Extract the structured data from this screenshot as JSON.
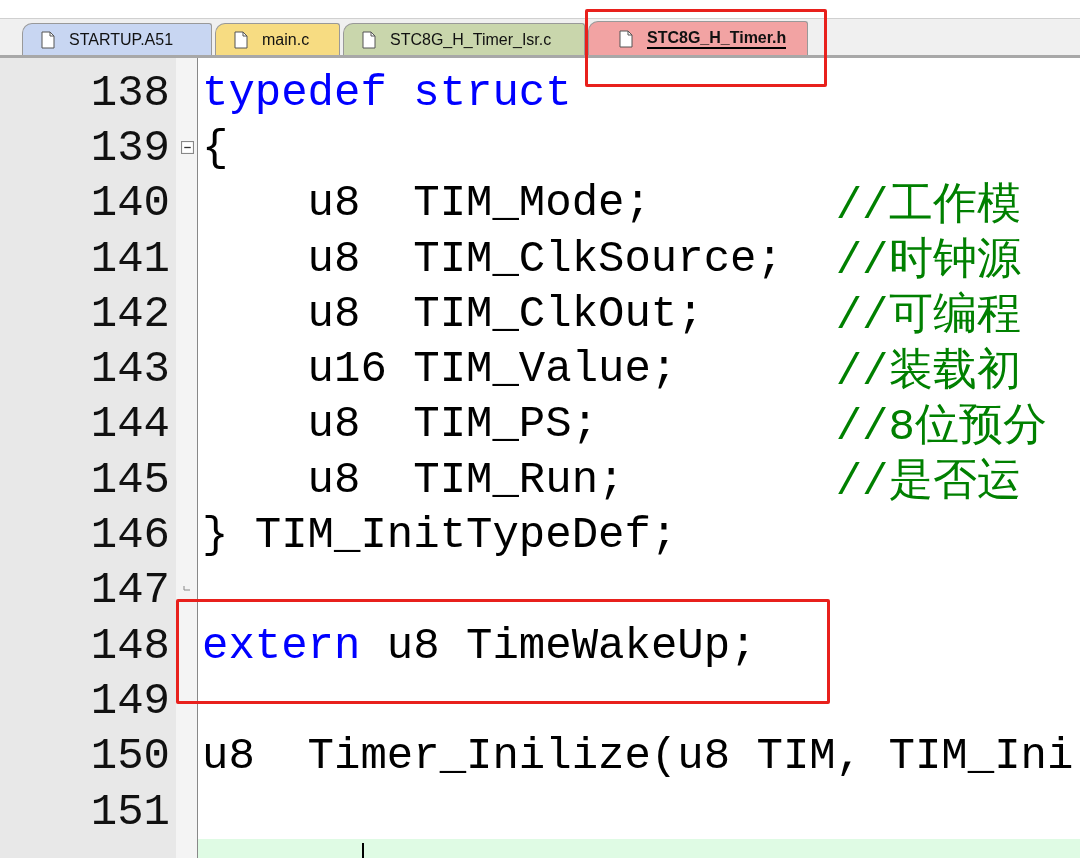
{
  "tabs": [
    {
      "label": "STARTUP.A51",
      "selected": false,
      "color": "#c8d6f2"
    },
    {
      "label": "main.c",
      "selected": false,
      "color": "#f7dc82"
    },
    {
      "label": "STC8G_H_Timer_Isr.c",
      "selected": false,
      "color": "#c9d6ac"
    },
    {
      "label": "STC8G_H_Timer.h",
      "selected": true,
      "color": "#f2a3a3"
    }
  ],
  "editor": {
    "lines": [
      {
        "number": "138",
        "tokens": [
          {
            "text": "typedef struct",
            "kind": "keyword"
          }
        ]
      },
      {
        "number": "139",
        "fold_start": true,
        "tokens": [
          {
            "text": "{",
            "kind": "text"
          }
        ]
      },
      {
        "number": "140",
        "tokens": [
          {
            "text": "    u8  TIM_Mode;",
            "kind": "text"
          },
          {
            "text": "//工作模",
            "kind": "comment"
          }
        ]
      },
      {
        "number": "141",
        "tokens": [
          {
            "text": "    u8  TIM_ClkSource;",
            "kind": "text"
          },
          {
            "text": "//时钟源",
            "kind": "comment"
          }
        ]
      },
      {
        "number": "142",
        "tokens": [
          {
            "text": "    u8  TIM_ClkOut;",
            "kind": "text"
          },
          {
            "text": "//可编程",
            "kind": "comment"
          }
        ]
      },
      {
        "number": "143",
        "tokens": [
          {
            "text": "    u16 TIM_Value;",
            "kind": "text"
          },
          {
            "text": "//装载初",
            "kind": "comment"
          }
        ]
      },
      {
        "number": "144",
        "tokens": [
          {
            "text": "    u8  TIM_PS;",
            "kind": "text"
          },
          {
            "text": "//8位预分",
            "kind": "comment"
          }
        ]
      },
      {
        "number": "145",
        "tokens": [
          {
            "text": "    u8  TIM_Run;",
            "kind": "text"
          },
          {
            "text": "//是否运",
            "kind": "comment"
          }
        ]
      },
      {
        "number": "146",
        "tokens": [
          {
            "text": "} TIM_InitTypeDef;",
            "kind": "text"
          }
        ]
      },
      {
        "number": "147",
        "fold_end": true
      },
      {
        "number": "148",
        "tokens": [
          {
            "text": "extern",
            "kind": "keyword"
          },
          {
            "text": " u8 TimeWakeUp;",
            "kind": "text"
          }
        ]
      },
      {
        "number": "149"
      },
      {
        "number": "150",
        "tokens": [
          {
            "text": "u8  Timer_Inilize(u8 TIM, TIM_Ini",
            "kind": "text"
          }
        ]
      },
      {
        "number": "151"
      },
      {
        "current": true
      }
    ]
  }
}
